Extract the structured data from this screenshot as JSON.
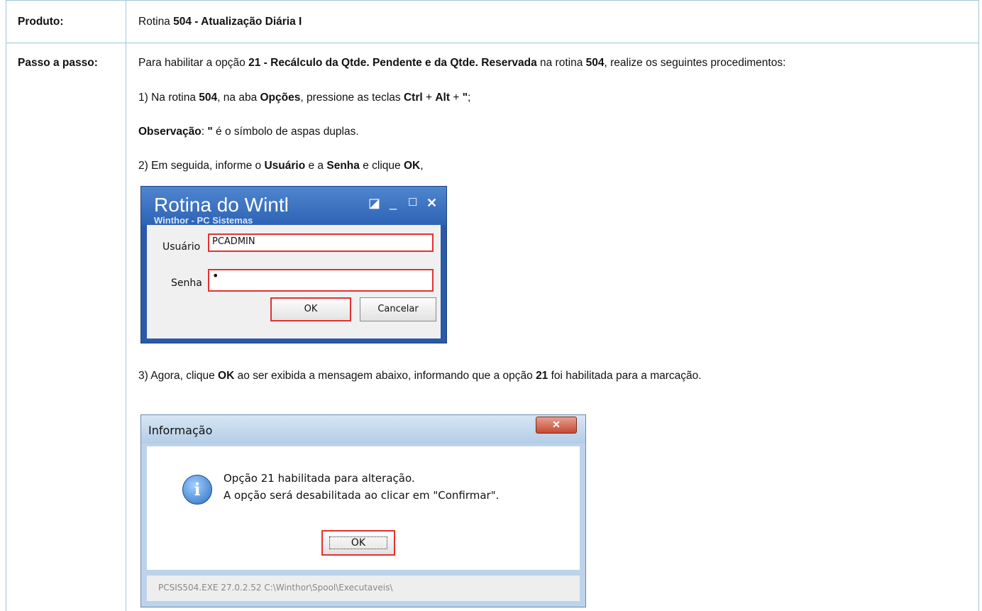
{
  "row_produto": {
    "label": "Produto:",
    "value_prefix": "Rotina ",
    "value_bold": "504 - Atualização Diária I"
  },
  "row_passo": {
    "label": "Passo a passo:",
    "intro": {
      "t1": "Para habilitar a opção ",
      "b1": "21 - Recálculo da Qtde. Pendente e da Qtde. Reservada",
      "t2": " na rotina ",
      "b2": "504",
      "t3": ", realize os seguintes procedimentos:"
    },
    "step1": {
      "t1": "1) Na rotina ",
      "b1": "504",
      "t2": ", na aba ",
      "b2": "Opções",
      "t3": ", pressione as teclas ",
      "b3": "Ctrl",
      "t4": " + ",
      "b4": "Alt",
      "t5": " + ",
      "b5": "\"",
      "t6": ";"
    },
    "note": {
      "b1": "Observação",
      "t1": ": ",
      "b2": "\"",
      "t2": " é o símbolo de aspas duplas."
    },
    "step2": {
      "t1": "2) Em seguida, informe o ",
      "b1": "Usuário",
      "t2": " e a ",
      "b2": "Senha",
      "t3": " e clique ",
      "b3": "OK",
      "t4": ","
    },
    "step3": {
      "t1": "3) Agora, clique ",
      "b1": "OK",
      "t2": " ao ser exibida a mensagem abaixo, informando que a opção ",
      "b2": "21",
      "t3": " foi habilitada para a marcação."
    }
  },
  "login_window": {
    "title": "Rotina do Wintl",
    "subtitle": "Winthor - PC Sistemas",
    "user_label": "Usuário",
    "user_value": "PCADMIN",
    "pass_label": "Senha",
    "pass_value": "•",
    "ok_label": "OK",
    "cancel_label": "Cancelar"
  },
  "info_dialog": {
    "title": "Informação",
    "line1": "Opção 21 habilitada para alteração.",
    "line2": "A opção será desabilitada ao clicar em \"Confirmar\".",
    "ok_label": "OK",
    "status": "PCSIS504.EXE 27.0.2.52 C:\\Winthor\\Spool\\Executaveis\\"
  }
}
